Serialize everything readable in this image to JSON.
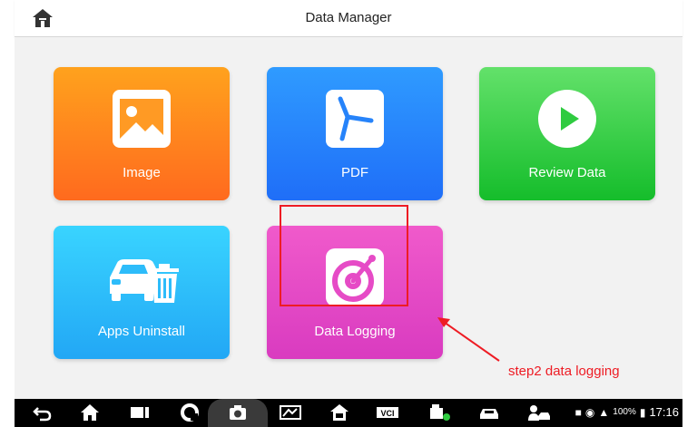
{
  "header": {
    "title": "Data Manager",
    "home_icon": "home-icon"
  },
  "tiles": [
    {
      "label": "Image",
      "icon": "image-icon"
    },
    {
      "label": "PDF",
      "icon": "pdf-icon"
    },
    {
      "label": "Review Data",
      "icon": "play-icon"
    },
    {
      "label": "Apps Uninstall",
      "icon": "car-trash-icon"
    },
    {
      "label": "Data Logging",
      "icon": "data-logging-icon"
    }
  ],
  "annotation": {
    "text": "step2 data logging",
    "color": "#ee1c24"
  },
  "navbar": {
    "icons": [
      "back-icon",
      "home-icon",
      "recent-apps-icon",
      "browser-icon",
      "camera-icon",
      "screen-capture-icon",
      "home-vehicle-icon",
      "vci-icon",
      "vehicle-connect-icon",
      "car-icon",
      "user-car-icon"
    ],
    "status": {
      "battery": "100%",
      "time": "17:16"
    }
  },
  "colors": {
    "image_tile": "#ff8a1e",
    "pdf_tile": "#2683fa",
    "review_tile": "#2fcb40",
    "apps_tile": "#2dbcfa",
    "logging_tile": "#e64bc6"
  }
}
